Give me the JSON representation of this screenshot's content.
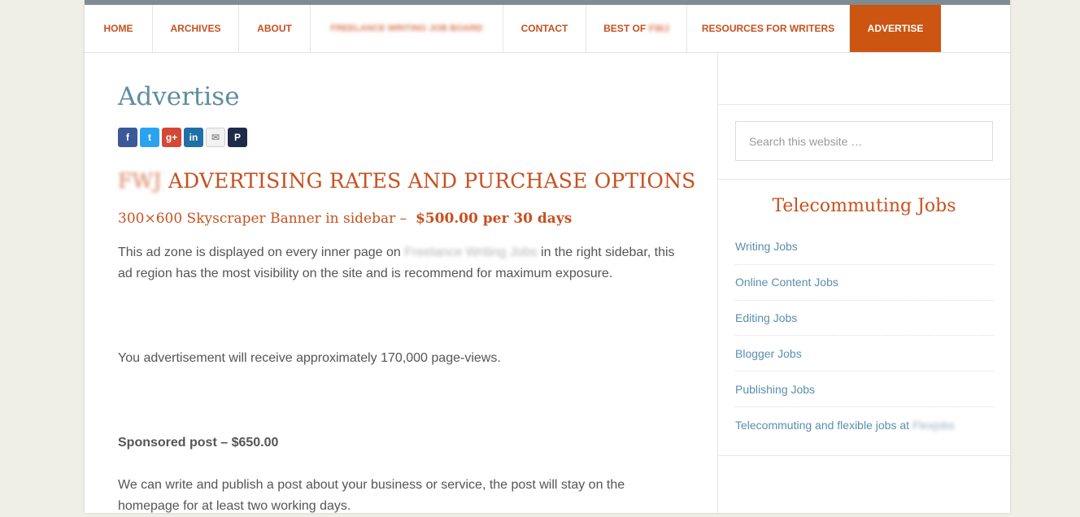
{
  "nav": {
    "home": "HOME",
    "archives": "ARCHIVES",
    "about": "ABOUT",
    "job_board": "FREELANCE WRITING JOB BOARD",
    "contact": "CONTACT",
    "best_of": "BEST OF",
    "best_of_suffix": "FWJ",
    "resources": "RESOURCES FOR WRITERS",
    "advertise": "ADVERTISE"
  },
  "page": {
    "title": "Advertise",
    "share": {
      "facebook": "f",
      "twitter": "t",
      "googleplus": "g+",
      "linkedin": "in",
      "email": "✉",
      "patreon": "P"
    },
    "heading_prefix": "FWJ",
    "heading": "ADVERTISING RATES AND PURCHASE OPTIONS",
    "subheading_text": "300×600 Skyscraper Banner in sidebar –",
    "subheading_price": "$500.00 per 30 days",
    "para1_before": "This ad zone is displayed on every inner page on",
    "para1_site": "Freelance Writing Jobs",
    "para1_after": "in the right sidebar, this ad region has the most visibility on the site and is recommend for maximum exposure.",
    "para2": "You advertisement will receive approximately 170,000 page-views.",
    "sponsored": "Sponsored post – $650.00",
    "para3": "We can write and publish a post about your business or service, the post will stay on the homepage for at least two working days."
  },
  "sidebar": {
    "search_placeholder": "Search this website …",
    "widget_title": "Telecommuting Jobs",
    "jobs": [
      "Writing Jobs",
      "Online Content Jobs",
      "Editing Jobs",
      "Blogger Jobs",
      "Publishing Jobs"
    ],
    "last_job_before": "Telecommuting and flexible jobs at",
    "last_job_site": "Flexjobs"
  },
  "colors": {
    "accent": "#c8501e",
    "active_nav_bg": "#cc5512",
    "title_blue": "#5f8da1",
    "link_blue": "#5a8eac",
    "body_text": "#555555",
    "page_bg": "#efefe6"
  }
}
